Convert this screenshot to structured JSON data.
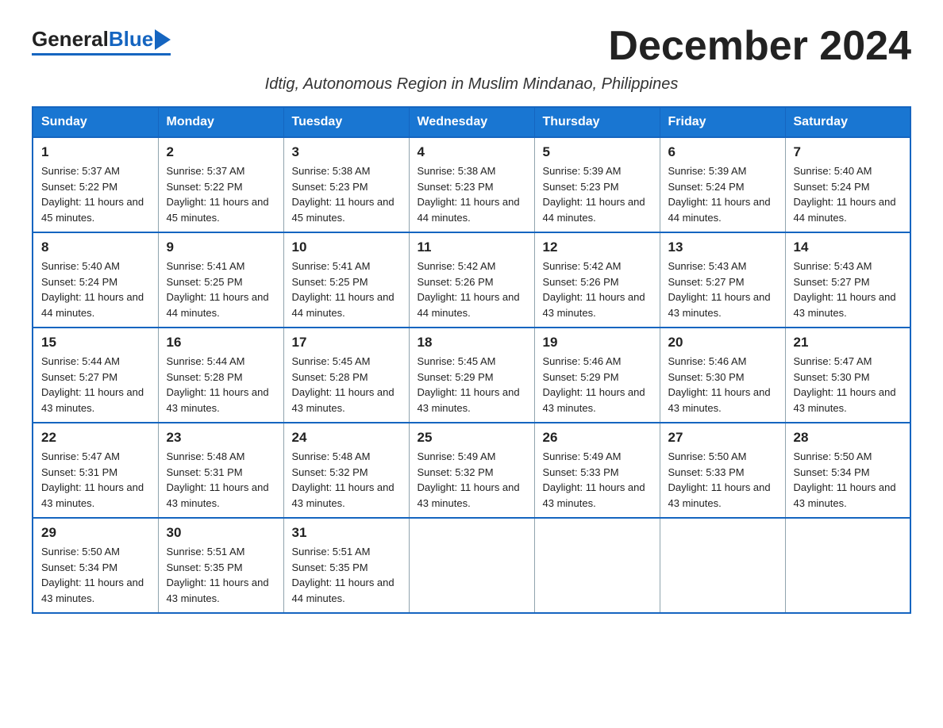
{
  "logo": {
    "general": "General",
    "blue": "Blue"
  },
  "title": "December 2024",
  "subtitle": "Idtig, Autonomous Region in Muslim Mindanao, Philippines",
  "weekdays": [
    "Sunday",
    "Monday",
    "Tuesday",
    "Wednesday",
    "Thursday",
    "Friday",
    "Saturday"
  ],
  "weeks": [
    [
      {
        "day": "1",
        "sunrise": "5:37 AM",
        "sunset": "5:22 PM",
        "daylight": "11 hours and 45 minutes."
      },
      {
        "day": "2",
        "sunrise": "5:37 AM",
        "sunset": "5:22 PM",
        "daylight": "11 hours and 45 minutes."
      },
      {
        "day": "3",
        "sunrise": "5:38 AM",
        "sunset": "5:23 PM",
        "daylight": "11 hours and 45 minutes."
      },
      {
        "day": "4",
        "sunrise": "5:38 AM",
        "sunset": "5:23 PM",
        "daylight": "11 hours and 44 minutes."
      },
      {
        "day": "5",
        "sunrise": "5:39 AM",
        "sunset": "5:23 PM",
        "daylight": "11 hours and 44 minutes."
      },
      {
        "day": "6",
        "sunrise": "5:39 AM",
        "sunset": "5:24 PM",
        "daylight": "11 hours and 44 minutes."
      },
      {
        "day": "7",
        "sunrise": "5:40 AM",
        "sunset": "5:24 PM",
        "daylight": "11 hours and 44 minutes."
      }
    ],
    [
      {
        "day": "8",
        "sunrise": "5:40 AM",
        "sunset": "5:24 PM",
        "daylight": "11 hours and 44 minutes."
      },
      {
        "day": "9",
        "sunrise": "5:41 AM",
        "sunset": "5:25 PM",
        "daylight": "11 hours and 44 minutes."
      },
      {
        "day": "10",
        "sunrise": "5:41 AM",
        "sunset": "5:25 PM",
        "daylight": "11 hours and 44 minutes."
      },
      {
        "day": "11",
        "sunrise": "5:42 AM",
        "sunset": "5:26 PM",
        "daylight": "11 hours and 44 minutes."
      },
      {
        "day": "12",
        "sunrise": "5:42 AM",
        "sunset": "5:26 PM",
        "daylight": "11 hours and 43 minutes."
      },
      {
        "day": "13",
        "sunrise": "5:43 AM",
        "sunset": "5:27 PM",
        "daylight": "11 hours and 43 minutes."
      },
      {
        "day": "14",
        "sunrise": "5:43 AM",
        "sunset": "5:27 PM",
        "daylight": "11 hours and 43 minutes."
      }
    ],
    [
      {
        "day": "15",
        "sunrise": "5:44 AM",
        "sunset": "5:27 PM",
        "daylight": "11 hours and 43 minutes."
      },
      {
        "day": "16",
        "sunrise": "5:44 AM",
        "sunset": "5:28 PM",
        "daylight": "11 hours and 43 minutes."
      },
      {
        "day": "17",
        "sunrise": "5:45 AM",
        "sunset": "5:28 PM",
        "daylight": "11 hours and 43 minutes."
      },
      {
        "day": "18",
        "sunrise": "5:45 AM",
        "sunset": "5:29 PM",
        "daylight": "11 hours and 43 minutes."
      },
      {
        "day": "19",
        "sunrise": "5:46 AM",
        "sunset": "5:29 PM",
        "daylight": "11 hours and 43 minutes."
      },
      {
        "day": "20",
        "sunrise": "5:46 AM",
        "sunset": "5:30 PM",
        "daylight": "11 hours and 43 minutes."
      },
      {
        "day": "21",
        "sunrise": "5:47 AM",
        "sunset": "5:30 PM",
        "daylight": "11 hours and 43 minutes."
      }
    ],
    [
      {
        "day": "22",
        "sunrise": "5:47 AM",
        "sunset": "5:31 PM",
        "daylight": "11 hours and 43 minutes."
      },
      {
        "day": "23",
        "sunrise": "5:48 AM",
        "sunset": "5:31 PM",
        "daylight": "11 hours and 43 minutes."
      },
      {
        "day": "24",
        "sunrise": "5:48 AM",
        "sunset": "5:32 PM",
        "daylight": "11 hours and 43 minutes."
      },
      {
        "day": "25",
        "sunrise": "5:49 AM",
        "sunset": "5:32 PM",
        "daylight": "11 hours and 43 minutes."
      },
      {
        "day": "26",
        "sunrise": "5:49 AM",
        "sunset": "5:33 PM",
        "daylight": "11 hours and 43 minutes."
      },
      {
        "day": "27",
        "sunrise": "5:50 AM",
        "sunset": "5:33 PM",
        "daylight": "11 hours and 43 minutes."
      },
      {
        "day": "28",
        "sunrise": "5:50 AM",
        "sunset": "5:34 PM",
        "daylight": "11 hours and 43 minutes."
      }
    ],
    [
      {
        "day": "29",
        "sunrise": "5:50 AM",
        "sunset": "5:34 PM",
        "daylight": "11 hours and 43 minutes."
      },
      {
        "day": "30",
        "sunrise": "5:51 AM",
        "sunset": "5:35 PM",
        "daylight": "11 hours and 43 minutes."
      },
      {
        "day": "31",
        "sunrise": "5:51 AM",
        "sunset": "5:35 PM",
        "daylight": "11 hours and 44 minutes."
      },
      null,
      null,
      null,
      null
    ]
  ]
}
